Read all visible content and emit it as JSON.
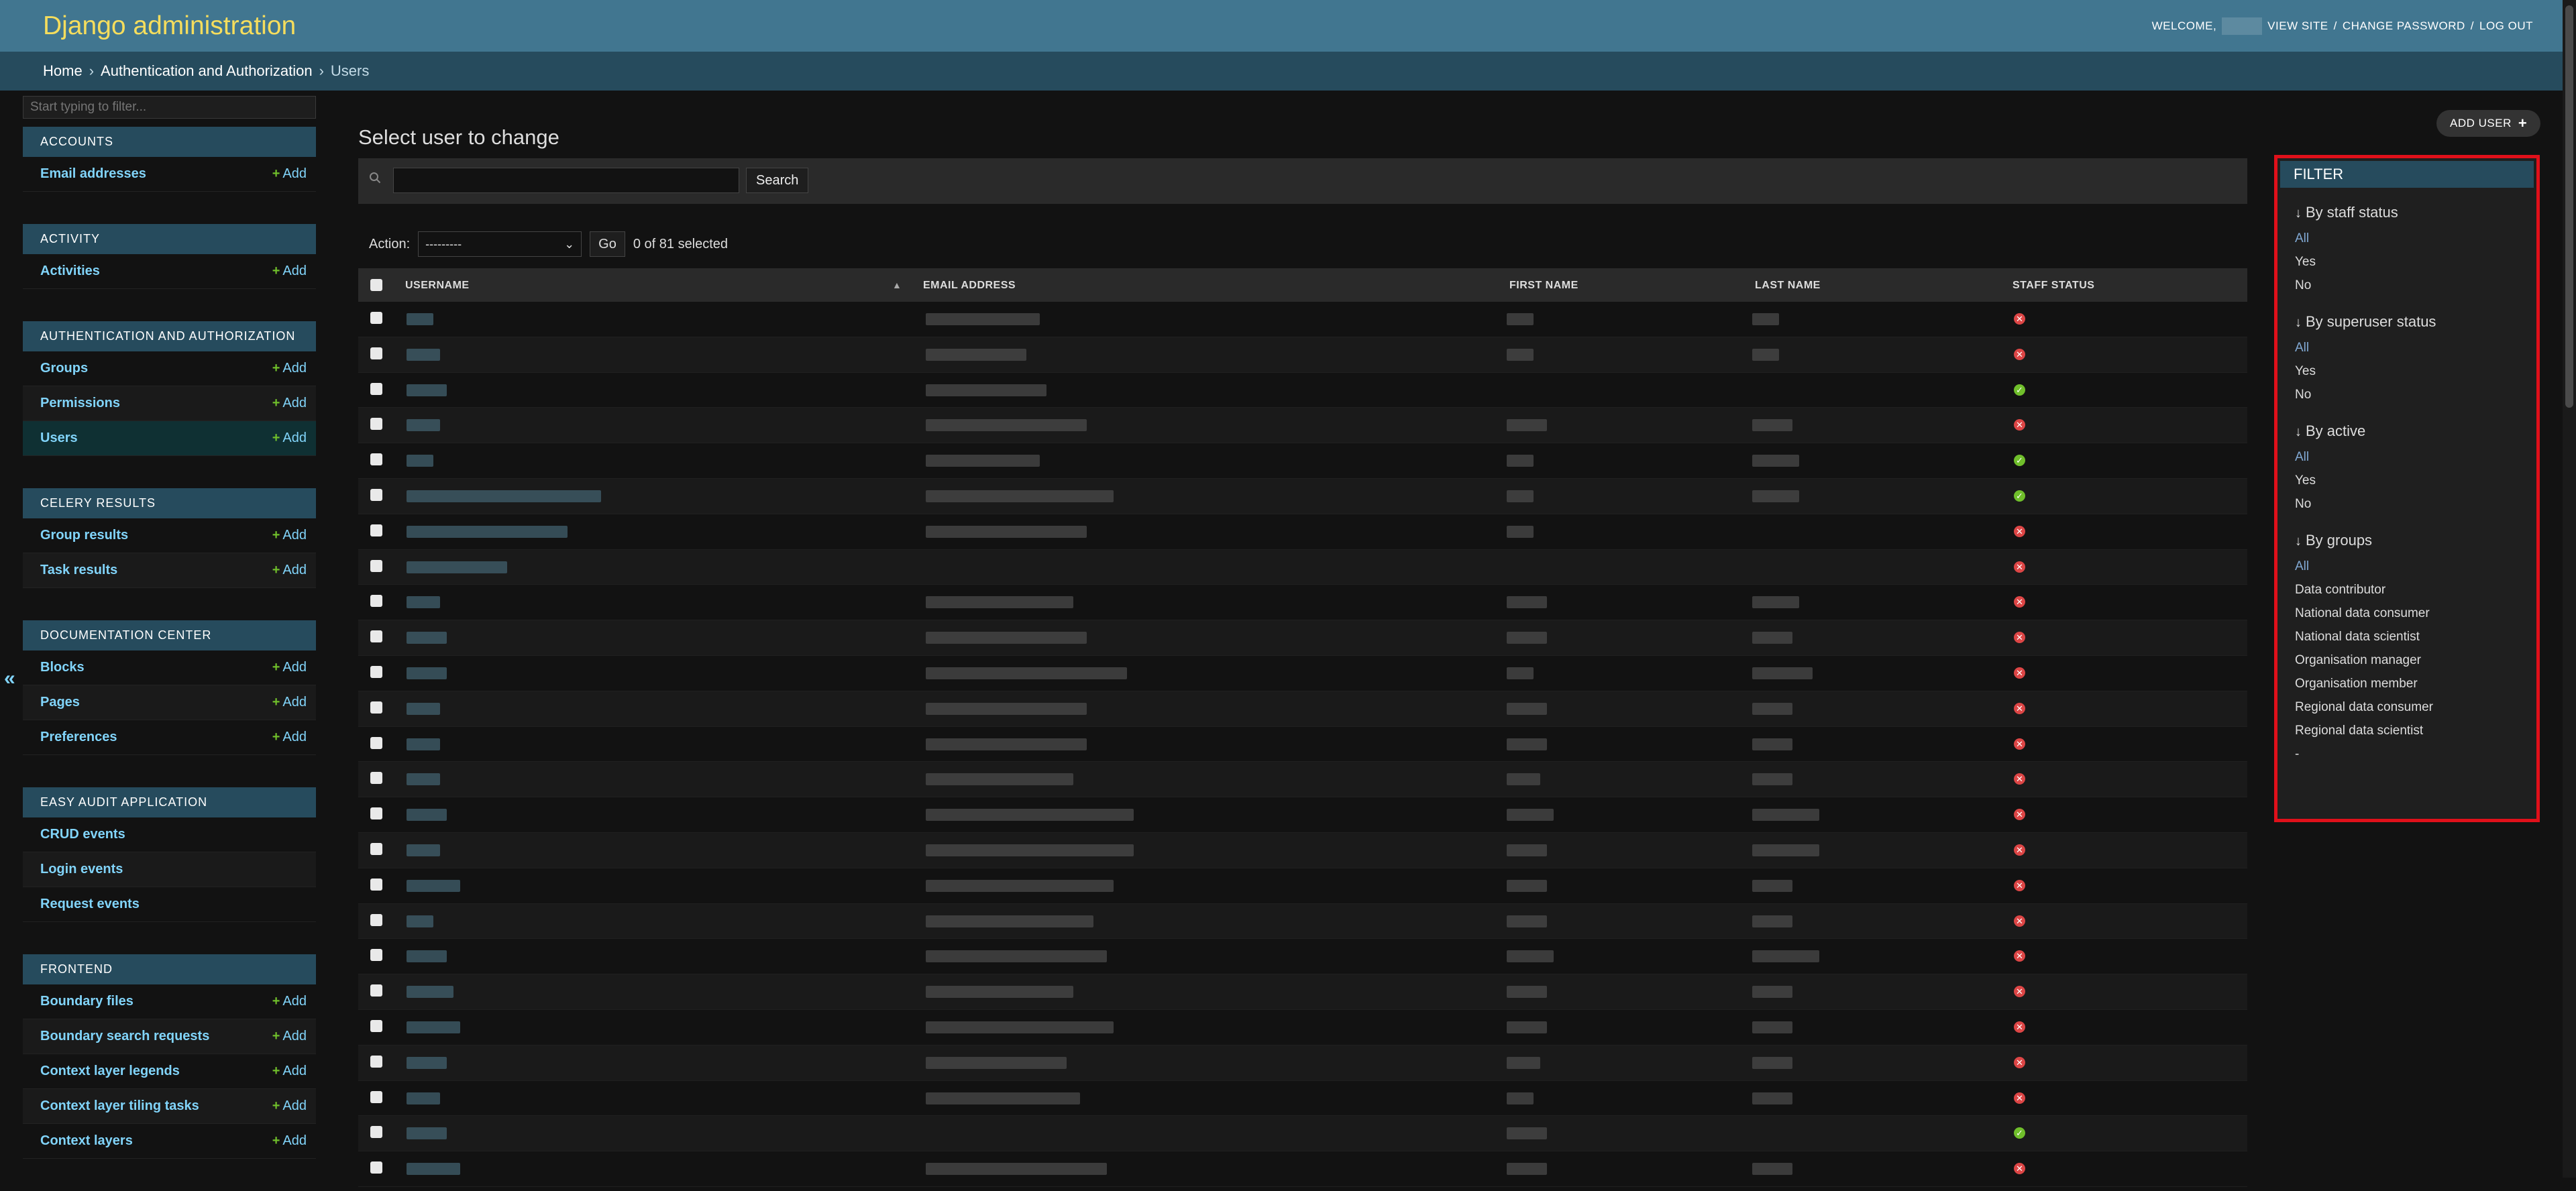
{
  "header": {
    "site_title": "Django administration",
    "welcome": "WELCOME,",
    "view_site": "VIEW SITE",
    "change_password": "CHANGE PASSWORD",
    "log_out": "LOG OUT",
    "separator": "/"
  },
  "breadcrumbs": {
    "home": "Home",
    "app": "Authentication and Authorization",
    "current": "Users",
    "sep": "›"
  },
  "sidebar": {
    "filter_placeholder": "Start typing to filter...",
    "toggle": "«",
    "add_label": "Add",
    "add_plus": "+",
    "modules": [
      {
        "caption": "ACCOUNTS",
        "models": [
          {
            "name": "Email addresses",
            "add": true
          }
        ]
      },
      {
        "caption": "ACTIVITY",
        "models": [
          {
            "name": "Activities",
            "add": true
          }
        ]
      },
      {
        "caption": "AUTHENTICATION AND AUTHORIZATION",
        "models": [
          {
            "name": "Groups",
            "add": true
          },
          {
            "name": "Permissions",
            "add": true
          },
          {
            "name": "Users",
            "add": true,
            "current": true
          }
        ]
      },
      {
        "caption": "CELERY RESULTS",
        "models": [
          {
            "name": "Group results",
            "add": true
          },
          {
            "name": "Task results",
            "add": true
          }
        ]
      },
      {
        "caption": "DOCUMENTATION CENTER",
        "models": [
          {
            "name": "Blocks",
            "add": true
          },
          {
            "name": "Pages",
            "add": true
          },
          {
            "name": "Preferences",
            "add": true
          }
        ]
      },
      {
        "caption": "EASY AUDIT APPLICATION",
        "models": [
          {
            "name": "CRUD events",
            "add": false
          },
          {
            "name": "Login events",
            "add": false
          },
          {
            "name": "Request events",
            "add": false
          }
        ]
      },
      {
        "caption": "FRONTEND",
        "models": [
          {
            "name": "Boundary files",
            "add": true
          },
          {
            "name": "Boundary search requests",
            "add": true
          },
          {
            "name": "Context layer legends",
            "add": true
          },
          {
            "name": "Context layer tiling tasks",
            "add": true
          },
          {
            "name": "Context layers",
            "add": true
          }
        ]
      }
    ]
  },
  "content": {
    "title": "Select user to change",
    "add_user": "ADD USER",
    "add_user_icon": "+",
    "search_button": "Search",
    "search_value": "",
    "action_label": "Action:",
    "action_selected": "---------",
    "go": "Go",
    "selection_count": "0 of 81 selected"
  },
  "table": {
    "columns": [
      "USERNAME",
      "EMAIL ADDRESS",
      "FIRST NAME",
      "LAST NAME",
      "STAFF STATUS"
    ],
    "sort_indicator": "▲",
    "staff_status": [
      "no",
      "no",
      "yes",
      "no",
      "yes",
      "yes",
      "no",
      "no",
      "no",
      "no",
      "no",
      "no",
      "no",
      "no",
      "no",
      "no",
      "no",
      "no",
      "no",
      "no",
      "no",
      "no",
      "no",
      "yes",
      "no"
    ]
  },
  "filter": {
    "title": "FILTER",
    "arrow": "↓",
    "sections": [
      {
        "heading": "By staff status",
        "choices": [
          "All",
          "Yes",
          "No"
        ]
      },
      {
        "heading": "By superuser status",
        "choices": [
          "All",
          "Yes",
          "No"
        ]
      },
      {
        "heading": "By active",
        "choices": [
          "All",
          "Yes",
          "No"
        ]
      },
      {
        "heading": "By groups",
        "choices": [
          "All",
          "Data contributor",
          "National data consumer",
          "National data scientist",
          "Organisation manager",
          "Organisation member",
          "Regional data consumer",
          "Regional data scientist",
          "-"
        ]
      }
    ]
  },
  "colors": {
    "header_bg": "#417690",
    "breadcrumb_bg": "#264b5d",
    "site_title": "#f5dd5d",
    "link": "#81d4fa",
    "add_plus": "#70bf2b",
    "status_yes": "#70bf2b",
    "status_no": "#dd4646",
    "highlight_border": "#e0101a"
  }
}
